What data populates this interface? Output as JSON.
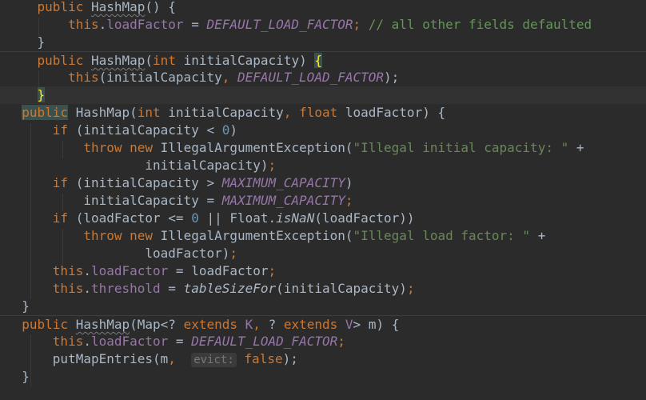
{
  "editor": {
    "language": "java",
    "lines": [
      {
        "indent": "    ",
        "tokens": [
          {
            "t": "public",
            "c": "kw"
          },
          {
            "t": " "
          },
          {
            "t": "HashMap",
            "c": "mth ctor-u"
          },
          {
            "t": "() {"
          }
        ]
      },
      {
        "indent": "        ",
        "tokens": [
          {
            "t": "this",
            "c": "kw"
          },
          {
            "t": "."
          },
          {
            "t": "loadFactor",
            "c": "fld"
          },
          {
            "t": " = "
          },
          {
            "t": "DEFAULT_LOAD_FACTOR",
            "c": "cst"
          },
          {
            "t": "; ",
            "c": "kw"
          },
          {
            "t": "// all other fields defaulted",
            "c": "cmt"
          }
        ]
      },
      {
        "indent": "    ",
        "tokens": [
          {
            "t": "}"
          }
        ]
      },
      {
        "indent": "    ",
        "sep": true,
        "tokens": [
          {
            "t": "public",
            "c": "kw"
          },
          {
            "t": " "
          },
          {
            "t": "HashMap",
            "c": "mth ctor-u"
          },
          {
            "t": "("
          },
          {
            "t": "int",
            "c": "kw"
          },
          {
            "t": " initialCapacity) "
          },
          {
            "t": "{",
            "c": "brace-hl"
          }
        ]
      },
      {
        "indent": "        ",
        "tokens": [
          {
            "t": "this",
            "c": "kw"
          },
          {
            "t": "(initialCapacity"
          },
          {
            "t": ", ",
            "c": "kw"
          },
          {
            "t": "DEFAULT_LOAD_FACTOR",
            "c": "cst"
          },
          {
            "t": ");"
          }
        ]
      },
      {
        "indent": "    ",
        "current": true,
        "tokens": [
          {
            "t": "}",
            "c": "brace-hl"
          }
        ]
      },
      {
        "indent": "  ",
        "tokens": [
          {
            "t": "public",
            "c": "kw kw-hl"
          },
          {
            "t": " HashMap("
          },
          {
            "t": "int",
            "c": "kw"
          },
          {
            "t": " initialCapacity"
          },
          {
            "t": ", ",
            "c": "kw"
          },
          {
            "t": "float",
            "c": "kw"
          },
          {
            "t": " loadFactor) {"
          }
        ]
      },
      {
        "indent": "      ",
        "tokens": [
          {
            "t": "if",
            "c": "kw"
          },
          {
            "t": " (initialCapacity < "
          },
          {
            "t": "0",
            "c": "num"
          },
          {
            "t": ")"
          }
        ]
      },
      {
        "indent": "          ",
        "tokens": [
          {
            "t": "throw",
            "c": "kw"
          },
          {
            "t": " "
          },
          {
            "t": "new",
            "c": "kw"
          },
          {
            "t": " IllegalArgumentException("
          },
          {
            "t": "\"Illegal initial capacity: \"",
            "c": "str"
          },
          {
            "t": " +"
          }
        ]
      },
      {
        "indent": "                  ",
        "tokens": [
          {
            "t": "initialCapacity)"
          },
          {
            "t": ";",
            "c": "kw"
          }
        ]
      },
      {
        "indent": "      ",
        "tokens": [
          {
            "t": "if",
            "c": "kw"
          },
          {
            "t": " (initialCapacity > "
          },
          {
            "t": "MAXIMUM_CAPACITY",
            "c": "cst"
          },
          {
            "t": ")"
          }
        ]
      },
      {
        "indent": "          ",
        "tokens": [
          {
            "t": "initialCapacity = "
          },
          {
            "t": "MAXIMUM_CAPACITY",
            "c": "cst"
          },
          {
            "t": ";",
            "c": "kw"
          }
        ]
      },
      {
        "indent": "      ",
        "tokens": [
          {
            "t": "if",
            "c": "kw"
          },
          {
            "t": " (loadFactor <= "
          },
          {
            "t": "0",
            "c": "num"
          },
          {
            "t": " || Float."
          },
          {
            "t": "isNaN",
            "c": "smth"
          },
          {
            "t": "(loadFactor))"
          }
        ]
      },
      {
        "indent": "          ",
        "tokens": [
          {
            "t": "throw",
            "c": "kw"
          },
          {
            "t": " "
          },
          {
            "t": "new",
            "c": "kw"
          },
          {
            "t": " IllegalArgumentException("
          },
          {
            "t": "\"Illegal load factor: \"",
            "c": "str"
          },
          {
            "t": " +"
          }
        ]
      },
      {
        "indent": "                  ",
        "tokens": [
          {
            "t": "loadFactor)"
          },
          {
            "t": ";",
            "c": "kw"
          }
        ]
      },
      {
        "indent": "      ",
        "tokens": [
          {
            "t": "this",
            "c": "kw"
          },
          {
            "t": "."
          },
          {
            "t": "loadFactor",
            "c": "fld"
          },
          {
            "t": " = loadFactor"
          },
          {
            "t": ";",
            "c": "kw"
          }
        ]
      },
      {
        "indent": "      ",
        "tokens": [
          {
            "t": "this",
            "c": "kw"
          },
          {
            "t": "."
          },
          {
            "t": "threshold",
            "c": "fld"
          },
          {
            "t": " = "
          },
          {
            "t": "tableSizeFor",
            "c": "smth"
          },
          {
            "t": "(initialCapacity)"
          },
          {
            "t": ";",
            "c": "kw"
          }
        ]
      },
      {
        "indent": "  ",
        "tokens": [
          {
            "t": "}"
          }
        ]
      },
      {
        "indent": "  ",
        "sep": true,
        "tokens": [
          {
            "t": "public",
            "c": "kw"
          },
          {
            "t": " "
          },
          {
            "t": "HashMap",
            "c": "mth ctor-u"
          },
          {
            "t": "(Map<? "
          },
          {
            "t": "extends",
            "c": "kw"
          },
          {
            "t": " "
          },
          {
            "t": "K",
            "c": "fld"
          },
          {
            "t": ", ",
            "c": "kw"
          },
          {
            "t": "? "
          },
          {
            "t": "extends",
            "c": "kw"
          },
          {
            "t": " "
          },
          {
            "t": "V",
            "c": "fld"
          },
          {
            "t": "> m) {"
          }
        ]
      },
      {
        "indent": "      ",
        "tokens": [
          {
            "t": "this",
            "c": "kw"
          },
          {
            "t": "."
          },
          {
            "t": "loadFactor",
            "c": "fld"
          },
          {
            "t": " = "
          },
          {
            "t": "DEFAULT_LOAD_FACTOR",
            "c": "cst"
          },
          {
            "t": ";",
            "c": "kw"
          }
        ]
      },
      {
        "indent": "      ",
        "tokens": [
          {
            "t": "putMapEntries(m"
          },
          {
            "t": ",  ",
            "c": "kw"
          },
          {
            "t": "evict:",
            "c": "hint"
          },
          {
            "t": " "
          },
          {
            "t": "false",
            "c": "kw"
          },
          {
            "t": ");"
          }
        ]
      },
      {
        "indent": "  ",
        "tokens": [
          {
            "t": "}"
          }
        ]
      }
    ]
  }
}
